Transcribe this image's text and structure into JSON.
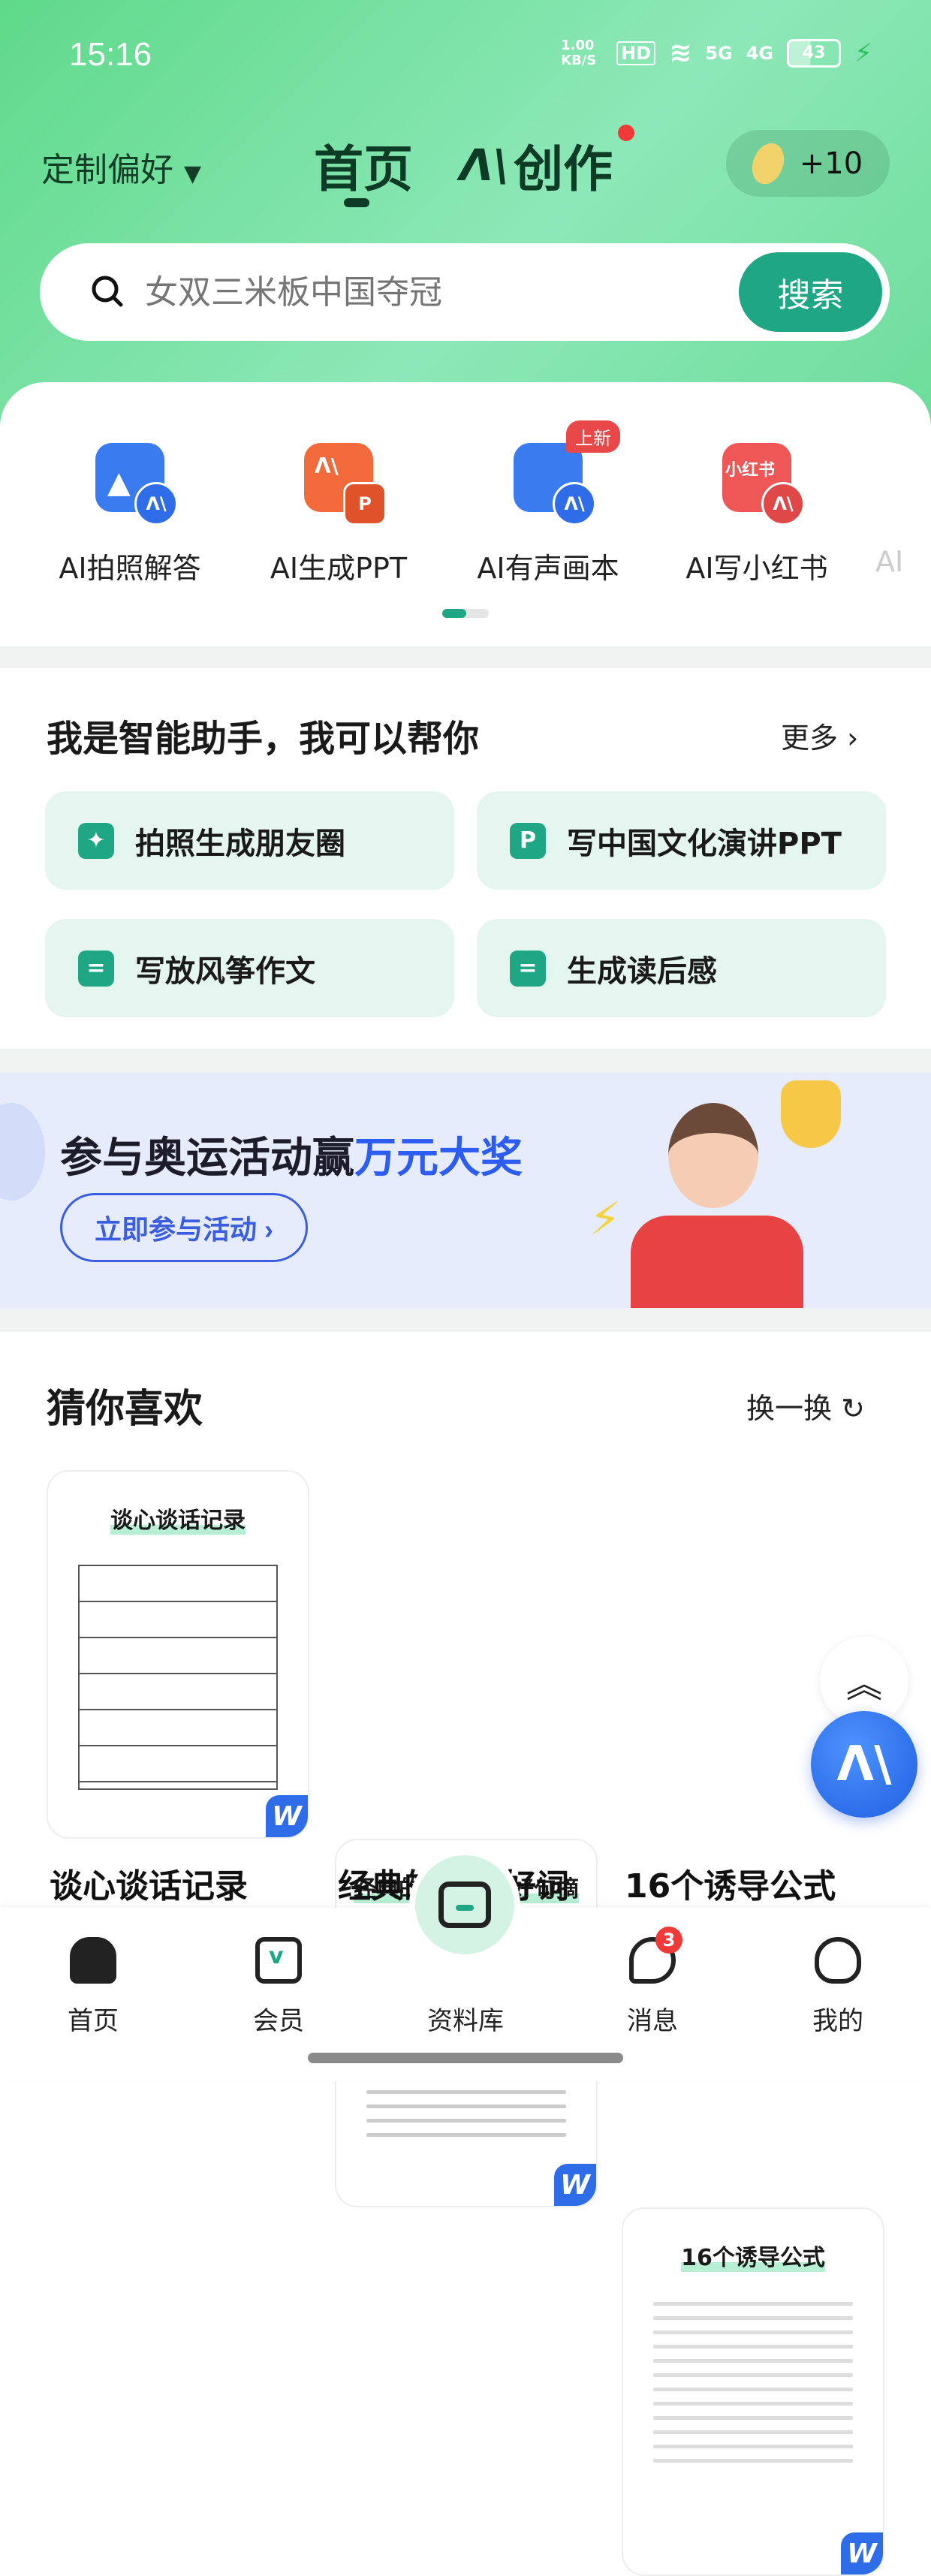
{
  "status": {
    "time": "15:16",
    "speed": "1.00 KB/S",
    "hd": "HD",
    "net1": "5G",
    "net2": "4G",
    "battery": "43"
  },
  "header": {
    "preference": "定制偏好",
    "tabs": [
      {
        "label": "首页"
      },
      {
        "label": "创作"
      }
    ],
    "coins": "+10"
  },
  "search": {
    "placeholder": "女双三米板中国夺冠",
    "button": "搜索"
  },
  "tools": [
    {
      "label": "AI拍照解答",
      "color": "#3b7bf0"
    },
    {
      "label": "AI生成PPT",
      "color": "#f26a3b"
    },
    {
      "label": "AI有声画本",
      "color": "#3b7bf0",
      "badge": "上新"
    },
    {
      "label": "AI写小红书",
      "color": "#ef5656",
      "icon_text": "小红书"
    },
    {
      "label": "AI"
    }
  ],
  "assistant": {
    "title": "我是智能助手，我可以帮你",
    "more": "更多",
    "items": [
      {
        "label": "拍照生成朋友圈",
        "icon": "magic-photo-icon"
      },
      {
        "label": "写中国文化演讲PPT",
        "icon": "ppt-icon",
        "icon_text": "P"
      },
      {
        "label": "写放风筝作文",
        "icon": "document-icon"
      },
      {
        "label": "生成读后感",
        "icon": "document-icon"
      }
    ]
  },
  "banner": {
    "title_main": "参与奥运活动赢",
    "title_highlight": "万元大奖",
    "button": "立即参与活动 ›"
  },
  "recommend": {
    "title": "猜你喜欢",
    "refresh": "换一换",
    "docs": [
      {
        "cover_title": "谈心谈话记录",
        "caption": "谈心谈话记录"
      },
      {
        "cover_title": "经典的优美好词好句摘",
        "caption": "经典的优美好词"
      },
      {
        "cover_title": "16个诱导公式",
        "caption": "16个诱导公式"
      }
    ],
    "doc_badge": "W"
  },
  "nav": [
    {
      "label": "首页"
    },
    {
      "label": "会员"
    },
    {
      "label": "资料库"
    },
    {
      "label": "消息",
      "badge": "3"
    },
    {
      "label": "我的"
    }
  ],
  "colors": {
    "accent": "#1fa684",
    "header_green": "#6bdc98",
    "banner_blue": "#2d5cf0",
    "badge_red": "#f03a3a"
  }
}
